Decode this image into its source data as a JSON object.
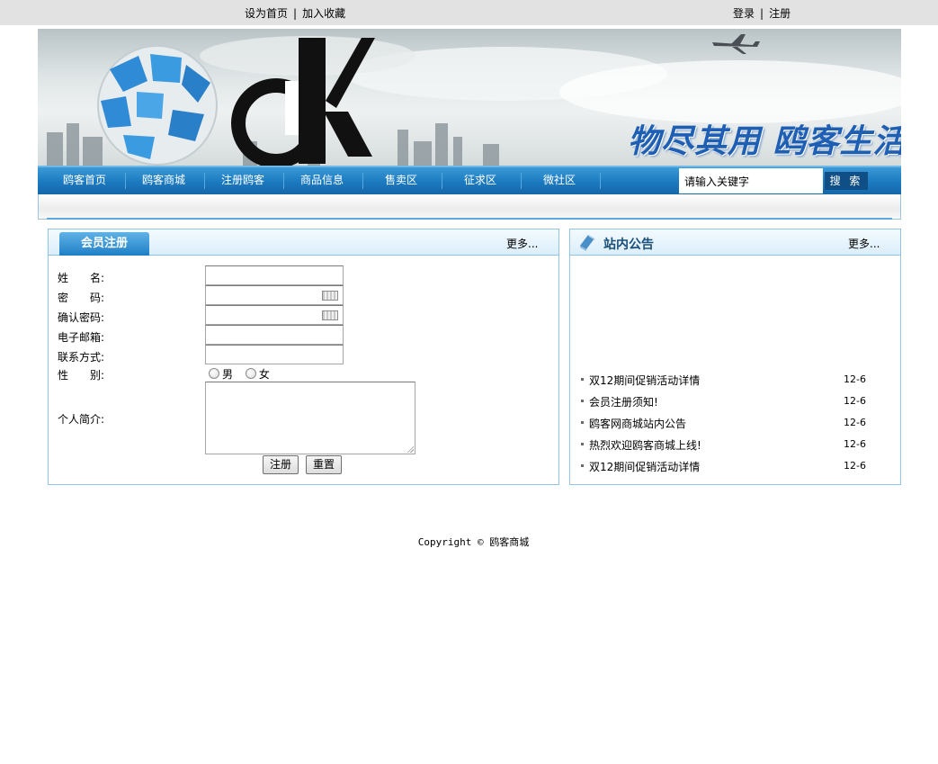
{
  "topbar": {
    "set_home": "设为首页",
    "add_favorite": "加入收藏",
    "login": "登录",
    "register": "注册",
    "separator": "|"
  },
  "banner": {
    "slogan": "物尽其用 鸥客生活",
    "logo_text": "cK"
  },
  "nav": {
    "items": [
      "鸥客首页",
      "鸥客商城",
      "注册鸥客",
      "商品信息",
      "售卖区",
      "征求区",
      "微社区"
    ],
    "search_value": "请输入关键字",
    "search_button": "搜 索"
  },
  "register_panel": {
    "title": "会员注册",
    "more": "更多...",
    "fields": {
      "name": "姓　　名:",
      "password": "密　　码:",
      "confirm_password": "确认密码:",
      "email": "电子邮箱:",
      "contact": "联系方式:",
      "gender": "性　　别:",
      "bio": "个人简介:"
    },
    "gender_options": [
      "男",
      "女"
    ],
    "submit_button": "注册",
    "reset_button": "重置"
  },
  "notice_panel": {
    "title": "站内公告",
    "more": "更多...",
    "items": [
      {
        "text": "双12期间促销活动详情",
        "date": "12-6"
      },
      {
        "text": "会员注册须知!",
        "date": "12-6"
      },
      {
        "text": "鸥客网商城站内公告",
        "date": "12-6"
      },
      {
        "text": "热烈欢迎鸥客商城上线!",
        "date": "12-6"
      },
      {
        "text": "双12期间促销活动详情",
        "date": "12-6"
      }
    ]
  },
  "footer": {
    "copyright": "Copyright © 鸥客商城"
  },
  "colors": {
    "nav_blue": "#1b79c0",
    "panel_border": "#93c4e4",
    "slogan_blue": "#1e5fb4",
    "topbar_gray": "#e2e2e2"
  }
}
